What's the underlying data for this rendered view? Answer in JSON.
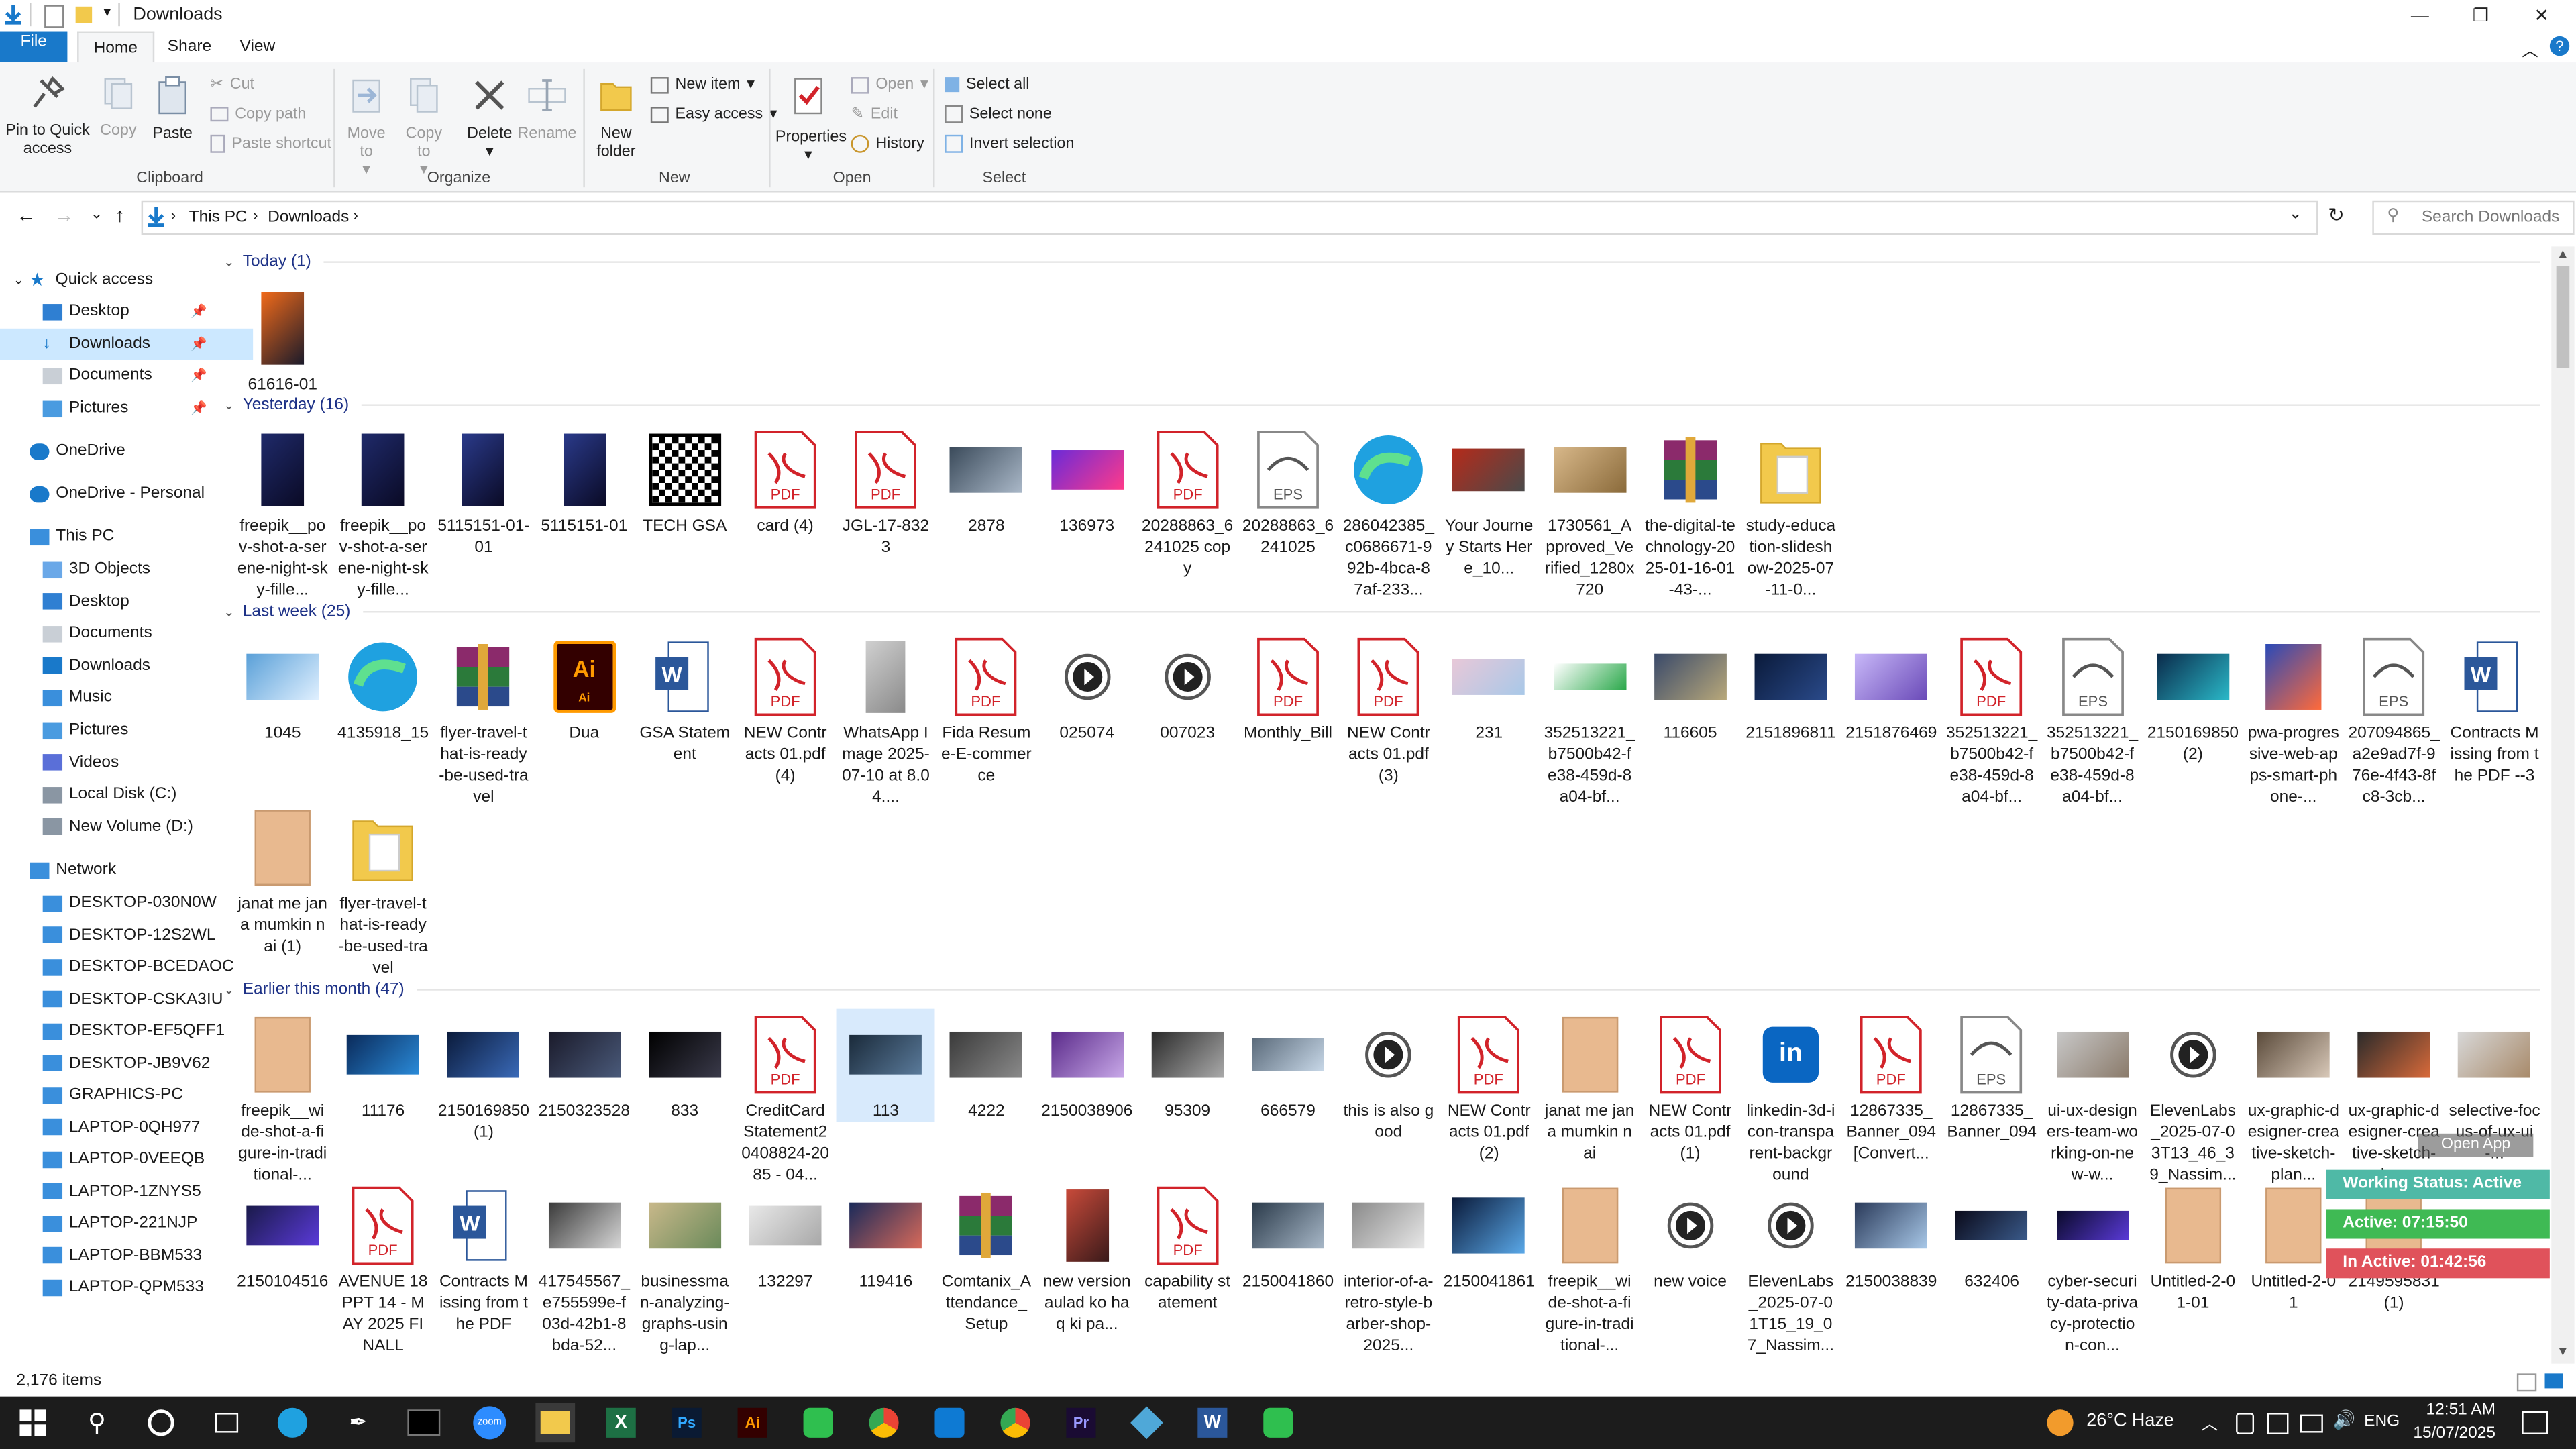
{
  "window": {
    "title": "Downloads"
  },
  "tabs": {
    "file": "File",
    "home": "Home",
    "share": "Share",
    "view": "View"
  },
  "ribbon": {
    "clipboard": {
      "pin": "Pin to Quick access",
      "copy": "Copy",
      "paste": "Paste",
      "cut": "Cut",
      "copy_path": "Copy path",
      "paste_shortcut": "Paste shortcut",
      "label": "Clipboard"
    },
    "organize": {
      "move_to": "Move to",
      "copy_to": "Copy to",
      "delete": "Delete",
      "rename": "Rename",
      "label": "Organize"
    },
    "new": {
      "new_folder": "New folder",
      "new_item": "New item",
      "easy_access": "Easy access",
      "label": "New"
    },
    "open": {
      "properties": "Properties",
      "open": "Open",
      "edit": "Edit",
      "history": "History",
      "label": "Open"
    },
    "select": {
      "select_all": "Select all",
      "select_none": "Select none",
      "invert": "Invert selection",
      "label": "Select"
    }
  },
  "address": {
    "this_pc": "This PC",
    "downloads": "Downloads",
    "search_placeholder": "Search Downloads"
  },
  "nav": {
    "quick_access": "Quick access",
    "quick": [
      "Desktop",
      "Downloads",
      "Documents",
      "Pictures"
    ],
    "onedrive": "OneDrive",
    "onedrive_personal": "OneDrive - Personal",
    "this_pc": "This PC",
    "pc_items": [
      "3D Objects",
      "Desktop",
      "Documents",
      "Downloads",
      "Music",
      "Pictures",
      "Videos",
      "Local Disk (C:)",
      "New Volume (D:)"
    ],
    "network": "Network",
    "network_items": [
      "DESKTOP-030N0W",
      "DESKTOP-12S2WL",
      "DESKTOP-BCEDAOC",
      "DESKTOP-CSKA3IU",
      "DESKTOP-EF5QFF1",
      "DESKTOP-JB9V62",
      "GRAPHICS-PC",
      "LAPTOP-0QH977",
      "LAPTOP-0VEEQB",
      "LAPTOP-1ZNYS5",
      "LAPTOP-221NJP",
      "LAPTOP-BBM533",
      "LAPTOP-QPM533"
    ]
  },
  "groups": {
    "today": "Today (1)",
    "yesterday": "Yesterday (16)",
    "last_week": "Last week (25)",
    "earlier": "Earlier this month (47)"
  },
  "files": {
    "today": [
      "61616-01"
    ],
    "yesterday": [
      "freepik__pov-shot-a-serene-night-sky-fille...",
      "freepik__pov-shot-a-serene-night-sky-fille...",
      "5115151-01-01",
      "5115151-01",
      "TECH GSA",
      "card (4)",
      "JGL-17-8323",
      "2878",
      "136973",
      "20288863_6241025 copy",
      "20288863_6241025",
      "286042385_c0686671-992b-4bca-87af-233...",
      "Your Journey Starts Here_10...",
      "1730561_Approved_Verified_1280x720",
      "the-digital-technology-2025-01-16-01-43-...",
      "study-education-slideshow-2025-07-11-0..."
    ],
    "last_week": [
      "1045",
      "4135918_15",
      "flyer-travel-that-is-ready-be-used-travel",
      "Dua",
      "GSA Statement",
      "NEW Contracts 01.pdf (4)",
      "WhatsApp Image 2025-07-10 at 8.04....",
      "Fida Resume-E-commerce",
      "025074",
      "007023",
      "Monthly_Bill",
      "NEW Contracts 01.pdf (3)",
      "231",
      "352513221_b7500b42-fe38-459d-8a04-bf...",
      "116605",
      "2151896811",
      "2151876469",
      "352513221_b7500b42-fe38-459d-8a04-bf...",
      "352513221_b7500b42-fe38-459d-8a04-bf...",
      "2150169850 (2)",
      "pwa-progressive-web-apps-smart-phone-...",
      "207094865_a2e9ad7f-976e-4f43-8fc8-3cb...",
      "Contracts Missing from the PDF --3",
      "janat me jana mumkin nai (1)",
      "flyer-travel-that-is-ready-be-used-travel"
    ],
    "earlier_row1": [
      "freepik__wide-shot-a-figure-in-traditional-...",
      "11176",
      "2150169850 (1)",
      "2150323528",
      "833",
      "CreditCard Statement20408824-2085 - 04...",
      "113",
      "4222",
      "2150038906",
      "95309",
      "666579",
      "this is also good",
      "NEW Contracts 01.pdf (2)",
      "janat me jana mumkin nai",
      "NEW Contracts 01.pdf (1)",
      "linkedin-3d-icon-transparent-background",
      "12867335_Banner_094 [Convert...",
      "12867335_Banner_094",
      "ui-ux-designers-team-working-on-new-w...",
      "ElevenLabs_2025-07-03T13_46_39_Nassim...",
      "ux-graphic-designer-creative-sketch-plan...",
      "ux-graphic-designer-creative-sketch-plan...",
      "selective-focus-of-ux-ui-..."
    ],
    "earlier_row2": [
      "2150104516",
      "AVENUE 18 PPT 14 - MAY 2025 FINALL",
      "Contracts Missing from the PDF",
      "417545567_e755599e-f03d-42b1-8bda-52...",
      "businessman-analyzing-graphs-using-lap...",
      "132297",
      "119416",
      "Comtanix_Attendance_Setup",
      "new version aulad ko haq ki pa...",
      "capability statement",
      "2150041860",
      "interior-of-a-retro-style-barber-shop-2025...",
      "2150041861",
      "freepik__wide-shot-a-figure-in-traditional-...",
      "new voice",
      "ElevenLabs_2025-07-01T15_19_07_Nassim...",
      "2150038839",
      "632406",
      "cyber-security-data-privacy-protection-con...",
      "Untitled-2-01-01",
      "Untitled-2-01",
      "2149595831 (1)"
    ]
  },
  "status": {
    "items": "2,176 items"
  },
  "widget": {
    "open_app": "Open App",
    "status": "Working Status: Active",
    "active": "Active: 07:15:50",
    "inactive": "In Active: 01:42:56"
  },
  "taskbar": {
    "weather": "26°C  Haze",
    "lang": "ENG",
    "time": "12:51 AM",
    "date": "15/07/2025"
  },
  "colors": {
    "accent": "#1979ca",
    "pdf": "#d2232a",
    "folder": "#f2c94c"
  }
}
